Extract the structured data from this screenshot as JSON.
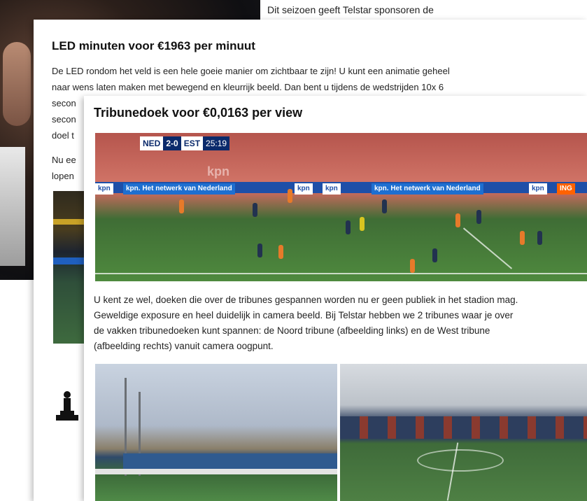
{
  "back_page": {
    "text": "Dit seizoen geeft Telstar sponsoren de"
  },
  "mid_page": {
    "heading": "LED minuten voor €1963 per minuut",
    "lines": [
      "De LED rondom het veld is een hele goeie manier om zichtbaar te zijn! U kunt een animatie geheel",
      "naar wens laten maken met bewegend en kleurrijk beeld. Dan bent u tijdens de wedstrijden 10x 6",
      "secon",
      "secon",
      "doel t",
      "Nu ee",
      "lopen"
    ]
  },
  "front_page": {
    "heading": "Tribunedoek voor €0,0163 per view",
    "scoreboard": {
      "home": "NED",
      "score": "2-0",
      "away": "EST",
      "clock": "25:19"
    },
    "sponsors": {
      "kpn_slogan": "kpn. Het netwerk van Nederland",
      "kpn": "kpn",
      "ing": "ING",
      "stand_text": "kpn"
    },
    "paragraph_lines": [
      "U kent ze wel, doeken die over de tribunes gespannen worden nu er geen publiek in het stadion mag.",
      "Geweldige exposure en heel duidelijk in camera beeld. Bij Telstar hebben we 2 tribunes waar je over",
      "de vakken tribunedoeken kunt spannen: de Noord tribune (afbeelding links) en de West tribune",
      "(afbeelding rechts) vanuit camera oogpunt."
    ]
  }
}
